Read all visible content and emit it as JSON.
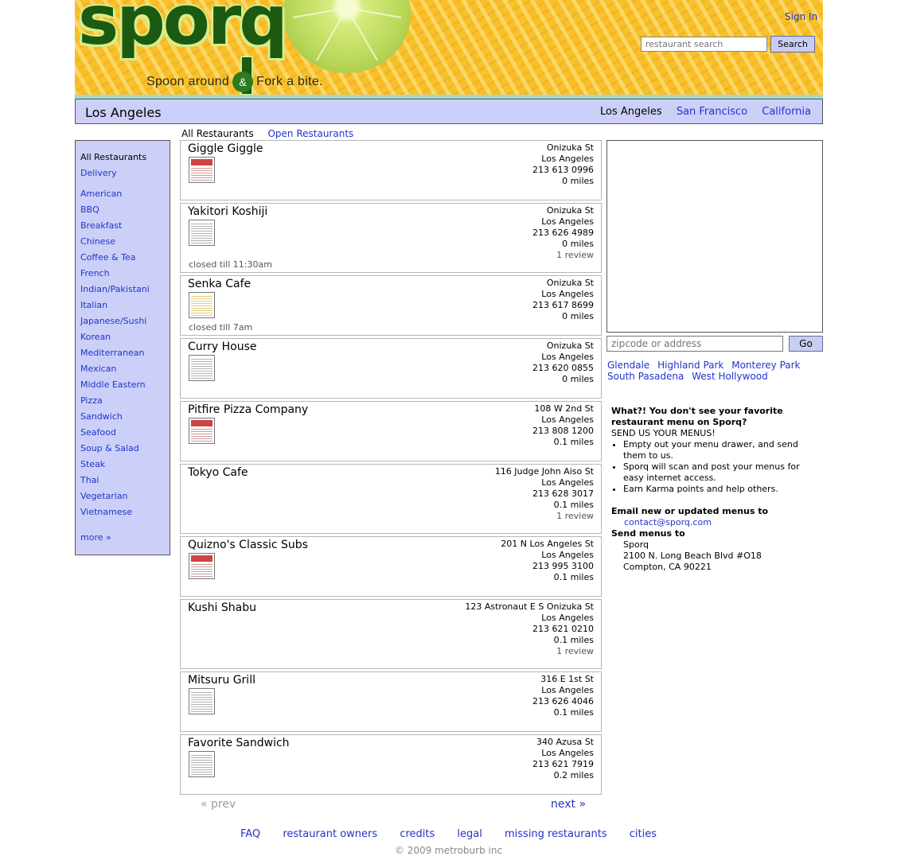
{
  "header": {
    "logo": "sporq",
    "tagline_left": "Spoon around",
    "tagline_amp": "&",
    "tagline_right": "Fork a bite.",
    "sign_in": "Sign In",
    "search_placeholder": "restaurant search",
    "search_button": "Search"
  },
  "citybar": {
    "title": "Los Angeles",
    "cities": [
      "Los Angeles",
      "San Francisco",
      "California"
    ]
  },
  "tabs": {
    "all": "All Restaurants",
    "open": "Open Restaurants"
  },
  "sidebar": {
    "all": "All Restaurants",
    "delivery": "Delivery",
    "categories": [
      "American",
      "BBQ",
      "Breakfast",
      "Chinese",
      "Coffee & Tea",
      "French",
      "Indian/Pakistani",
      "Italian",
      "Japanese/Sushi",
      "Korean",
      "Mediterranean",
      "Mexican",
      "Middle Eastern",
      "Pizza",
      "Sandwich",
      "Seafood",
      "Soup & Salad",
      "Steak",
      "Thai",
      "Vegetarian",
      "Vietnamese"
    ],
    "more": "more »"
  },
  "restaurants": [
    {
      "name": "Giggle Giggle",
      "street": "Onizuka St",
      "city": "Los Angeles",
      "phone": "213 613 0996",
      "distance": "0 miles",
      "review": "",
      "status": "",
      "thumb_icon": "menu-thumbnail-icon"
    },
    {
      "name": "Yakitori Koshiji",
      "street": "Onizuka St",
      "city": "Los Angeles",
      "phone": "213 626 4989",
      "distance": "0 miles",
      "review": "1 review",
      "status": "closed till 11:30am",
      "thumb_icon": "menu-thumbnail-icon"
    },
    {
      "name": "Senka Cafe",
      "street": "Onizuka St",
      "city": "Los Angeles",
      "phone": "213 617 8699",
      "distance": "0 miles",
      "review": "",
      "status": "closed till 7am",
      "thumb_icon": "menu-thumbnail-icon"
    },
    {
      "name": "Curry House",
      "street": "Onizuka St",
      "city": "Los Angeles",
      "phone": "213 620 0855",
      "distance": "0 miles",
      "review": "",
      "status": "",
      "thumb_icon": "menu-thumbnail-icon"
    },
    {
      "name": "Pitfire Pizza Company",
      "street": "108 W 2nd St",
      "city": "Los Angeles",
      "phone": "213 808 1200",
      "distance": "0.1 miles",
      "review": "",
      "status": "",
      "thumb_icon": "menu-thumbnail-icon"
    },
    {
      "name": "Tokyo Cafe",
      "street": "116 Judge John Aiso St",
      "city": "Los Angeles",
      "phone": "213 628 3017",
      "distance": "0.1 miles",
      "review": "1 review",
      "status": "",
      "thumb_icon": ""
    },
    {
      "name": "Quizno's Classic Subs",
      "street": "201 N Los Angeles St",
      "city": "Los Angeles",
      "phone": "213 995 3100",
      "distance": "0.1 miles",
      "review": "",
      "status": "",
      "thumb_icon": "menu-thumbnail-icon"
    },
    {
      "name": "Kushi Shabu",
      "street": "123 Astronaut E S Onizuka St",
      "city": "Los Angeles",
      "phone": "213 621 0210",
      "distance": "0.1 miles",
      "review": "1 review",
      "status": "",
      "thumb_icon": ""
    },
    {
      "name": "Mitsuru Grill",
      "street": "316 E 1st St",
      "city": "Los Angeles",
      "phone": "213 626 4046",
      "distance": "0.1 miles",
      "review": "",
      "status": "",
      "thumb_icon": "menu-thumbnail-icon"
    },
    {
      "name": "Favorite Sandwich",
      "street": "340 Azusa St",
      "city": "Los Angeles",
      "phone": "213 621 7919",
      "distance": "0.2 miles",
      "review": "",
      "status": "",
      "thumb_icon": "menu-thumbnail-icon"
    }
  ],
  "pager": {
    "prev": "« prev",
    "next": "next »"
  },
  "location": {
    "placeholder": "zipcode or address",
    "go": "Go",
    "neighborhoods": [
      "Glendale",
      "Highland Park",
      "Monterey Park",
      "South Pasadena",
      "West Hollywood"
    ]
  },
  "info": {
    "heading": "What?! You don't see your favorite restaurant menu on Sporq?",
    "send_us": "SEND US YOUR MENUS!",
    "bullets": [
      "Empty out your menu drawer, and send them to us.",
      "Sporq will scan and post your menus for easy internet access.",
      "Earn Karma points and help others."
    ],
    "email_label": "Email new or updated menus to",
    "email": "contact@sporq.com",
    "send_label": "Send menus to",
    "addr_name": "Sporq",
    "addr_street": "2100 N. Long Beach Blvd #O18",
    "addr_city": "Compton, CA 90221"
  },
  "footer": {
    "links": [
      "FAQ",
      "restaurant owners",
      "credits",
      "legal",
      "missing restaurants",
      "cities"
    ],
    "copyright": "© 2009 metroburb inc"
  },
  "colors": {
    "link": "#2233cc",
    "panel": "#ccd0f8",
    "header": "#f8c02a",
    "logo": "#1c5a12"
  }
}
